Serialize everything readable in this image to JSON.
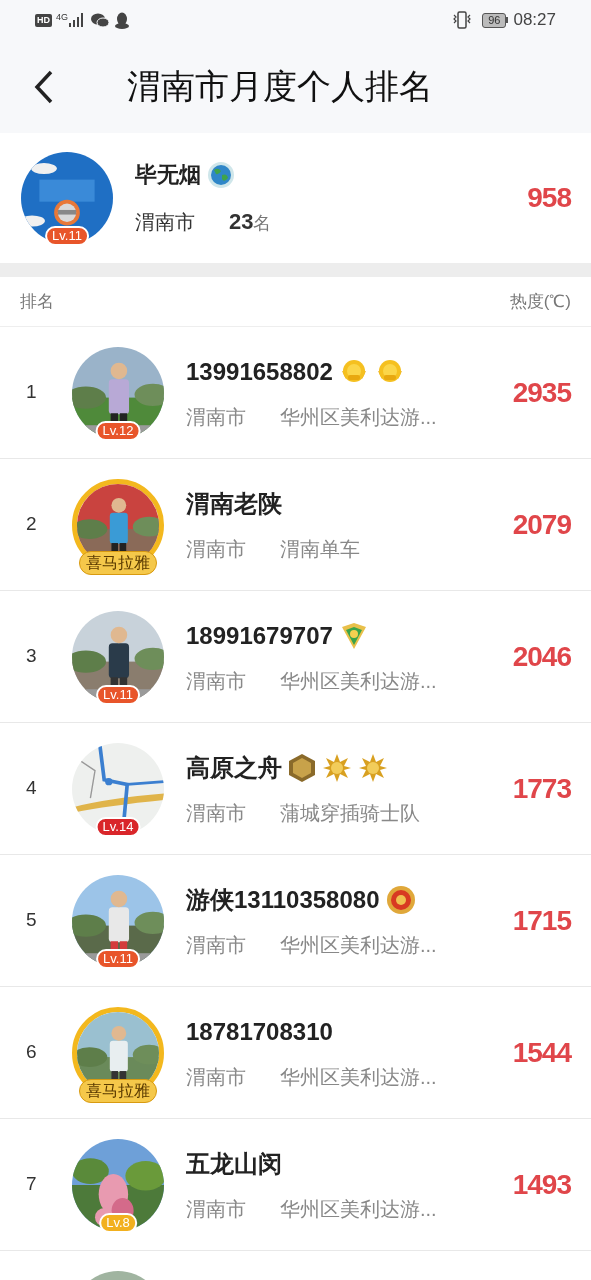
{
  "status_bar": {
    "network": "HD",
    "mobile": "4G",
    "battery": "96",
    "time": "08:27"
  },
  "header": {
    "title": "渭南市月度个人排名"
  },
  "me": {
    "avatar": {
      "kind": "picture",
      "badge": {
        "kind": "level",
        "text": "Lv.11",
        "color": "#e8552a"
      }
    },
    "name": "毕无烟",
    "badges": [
      {
        "kind": "globe"
      }
    ],
    "city": "渭南市",
    "rank": "23",
    "rank_unit": "名",
    "score": "958"
  },
  "columns": [
    "排名",
    "热度(℃)"
  ],
  "rows": [
    {
      "rank": "1",
      "avatar": {
        "kind": "picture",
        "badge": {
          "kind": "level",
          "text": "Lv.12",
          "color": "#e8552a"
        }
      },
      "name": "13991658802",
      "badges": [
        {
          "kind": "medal"
        },
        {
          "kind": "medal"
        }
      ],
      "city": "渭南市",
      "team": "华州区美利达游...",
      "score": "2935"
    },
    {
      "rank": "2",
      "avatar": {
        "kind": "picture",
        "badge": {
          "kind": "frame",
          "text": "喜马拉雅",
          "color": "#f5c84a"
        }
      },
      "name": "渭南老陕",
      "badges": [],
      "city": "渭南市",
      "team": "渭南单车",
      "score": "2079"
    },
    {
      "rank": "3",
      "avatar": {
        "kind": "picture",
        "badge": {
          "kind": "level",
          "text": "Lv.11",
          "color": "#e8552a"
        }
      },
      "name": "18991679707",
      "badges": [
        {
          "kind": "shield"
        }
      ],
      "city": "渭南市",
      "team": "华州区美利达游...",
      "score": "2046"
    },
    {
      "rank": "4",
      "avatar": {
        "kind": "picture",
        "badge": {
          "kind": "level",
          "text": "Lv.14",
          "color": "#d9262a"
        }
      },
      "name": "高原之舟",
      "badges": [
        {
          "kind": "hexagon"
        },
        {
          "kind": "star"
        },
        {
          "kind": "star"
        }
      ],
      "city": "渭南市",
      "team": "蒲城穿插骑士队",
      "score": "1773"
    },
    {
      "rank": "5",
      "avatar": {
        "kind": "picture",
        "badge": {
          "kind": "level",
          "text": "Lv.11",
          "color": "#e8552a"
        }
      },
      "name": "游侠13110358080",
      "badges": [
        {
          "kind": "ring"
        }
      ],
      "city": "渭南市",
      "team": "华州区美利达游...",
      "score": "1715"
    },
    {
      "rank": "6",
      "avatar": {
        "kind": "picture",
        "badge": {
          "kind": "frame",
          "text": "喜马拉雅",
          "color": "#f5c84a"
        }
      },
      "name": "18781708310",
      "badges": [],
      "city": "渭南市",
      "team": "华州区美利达游...",
      "score": "1544"
    },
    {
      "rank": "7",
      "avatar": {
        "kind": "picture",
        "badge": {
          "kind": "level",
          "text": "Lv.8",
          "color": "#f2b01e"
        }
      },
      "name": "五龙山闵",
      "badges": [],
      "city": "渭南市",
      "team": "华州区美利达游...",
      "score": "1493"
    },
    {
      "avatar": {
        "kind": "picture"
      }
    }
  ]
}
